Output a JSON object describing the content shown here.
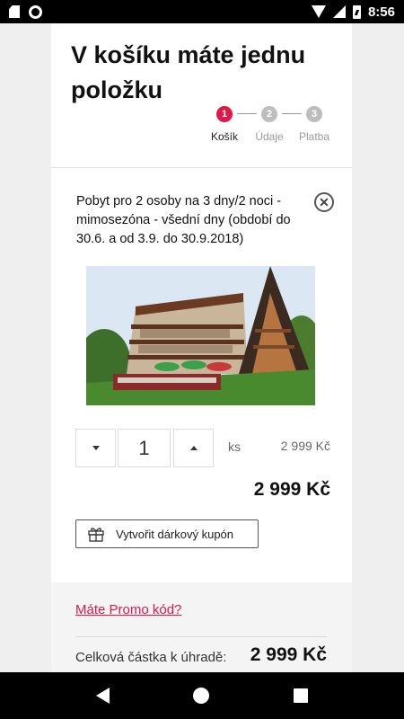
{
  "status_bar": {
    "time": "8:56"
  },
  "page": {
    "title": "V košíku máte jednu položku",
    "steps": [
      {
        "number": "1",
        "label": "Košík",
        "active": true
      },
      {
        "number": "2",
        "label": "Údaje",
        "active": false
      },
      {
        "number": "3",
        "label": "Platba",
        "active": false
      }
    ]
  },
  "cart_item": {
    "name": "Pobyt pro 2 osoby na 3 dny/2 noci - mimosezóna - všední dny (období do 30.6. a od 3.9. do 30.9.2018)",
    "image_alt": "Hotel Barbora",
    "quantity": "1",
    "unit": "ks",
    "unit_price": "2 999 Kč",
    "line_total": "2 999 Kč",
    "gift_button_label": "Vytvořit dárkový kupón"
  },
  "summary": {
    "promo_link": "Máte Promo kód?",
    "total_label": "Celková částka k úhradě:",
    "total_value": "2 999 Kč"
  },
  "colors": {
    "accent": "#e0184a",
    "step_inactive": "#bdbdbd"
  },
  "icons": {
    "remove": "close-circle-icon",
    "gift": "gift-icon",
    "minus": "triangle-down-icon",
    "plus": "triangle-up-icon"
  }
}
